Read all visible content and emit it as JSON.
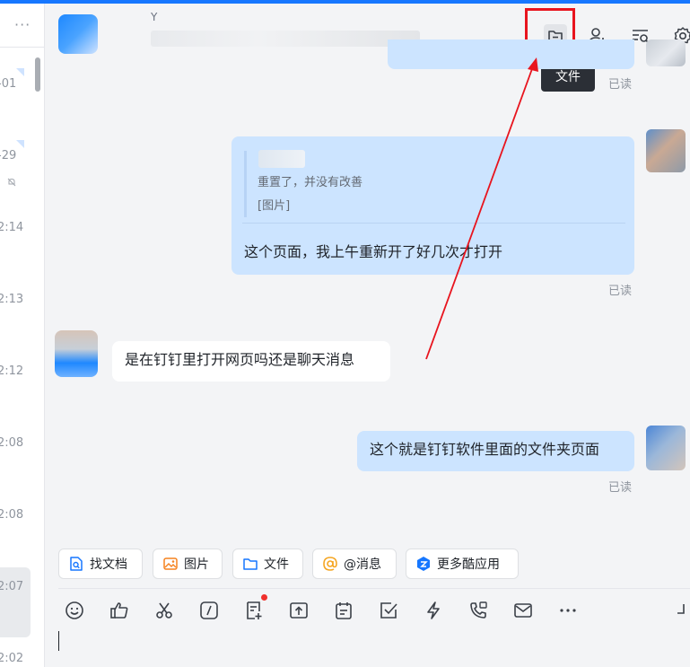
{
  "left_list": {
    "more": "···",
    "times": [
      "-01",
      "-29",
      "2:14",
      "2:13",
      "2:12",
      "2:08",
      "2:08",
      "2:07",
      "2:02"
    ]
  },
  "header": {
    "title_partial": "Y",
    "tooltip": "文件"
  },
  "messages": {
    "read_label": "已读",
    "quote_line1": "重置了，并没有改善",
    "quote_line2": "[图片]",
    "msg1": "这个页面，我上午重新开了好几次才打开",
    "msg2": "是在钉钉里打开网页吗还是聊天消息",
    "msg3": "这个就是钉钉软件里面的文件夹页面"
  },
  "chips": {
    "find_doc": "找文档",
    "image": "图片",
    "file": "文件",
    "mention": "@消息",
    "more_apps": "更多酷应用"
  },
  "colors": {
    "accent": "#1677ff",
    "my_bubble": "#cce4ff",
    "highlight_red": "#e8141e"
  },
  "icons": {
    "header": [
      "folder-icon",
      "add-member-icon",
      "search-history-icon",
      "settings-icon"
    ],
    "toolbar": [
      "emoji-icon",
      "thumbs-up-icon",
      "scissors-icon",
      "slash-command-icon",
      "note-add-icon",
      "upload-folder-icon",
      "calendar-icon",
      "task-check-icon",
      "lightning-icon",
      "phone-icon",
      "mail-icon",
      "more-icon",
      "expand-icon"
    ]
  }
}
